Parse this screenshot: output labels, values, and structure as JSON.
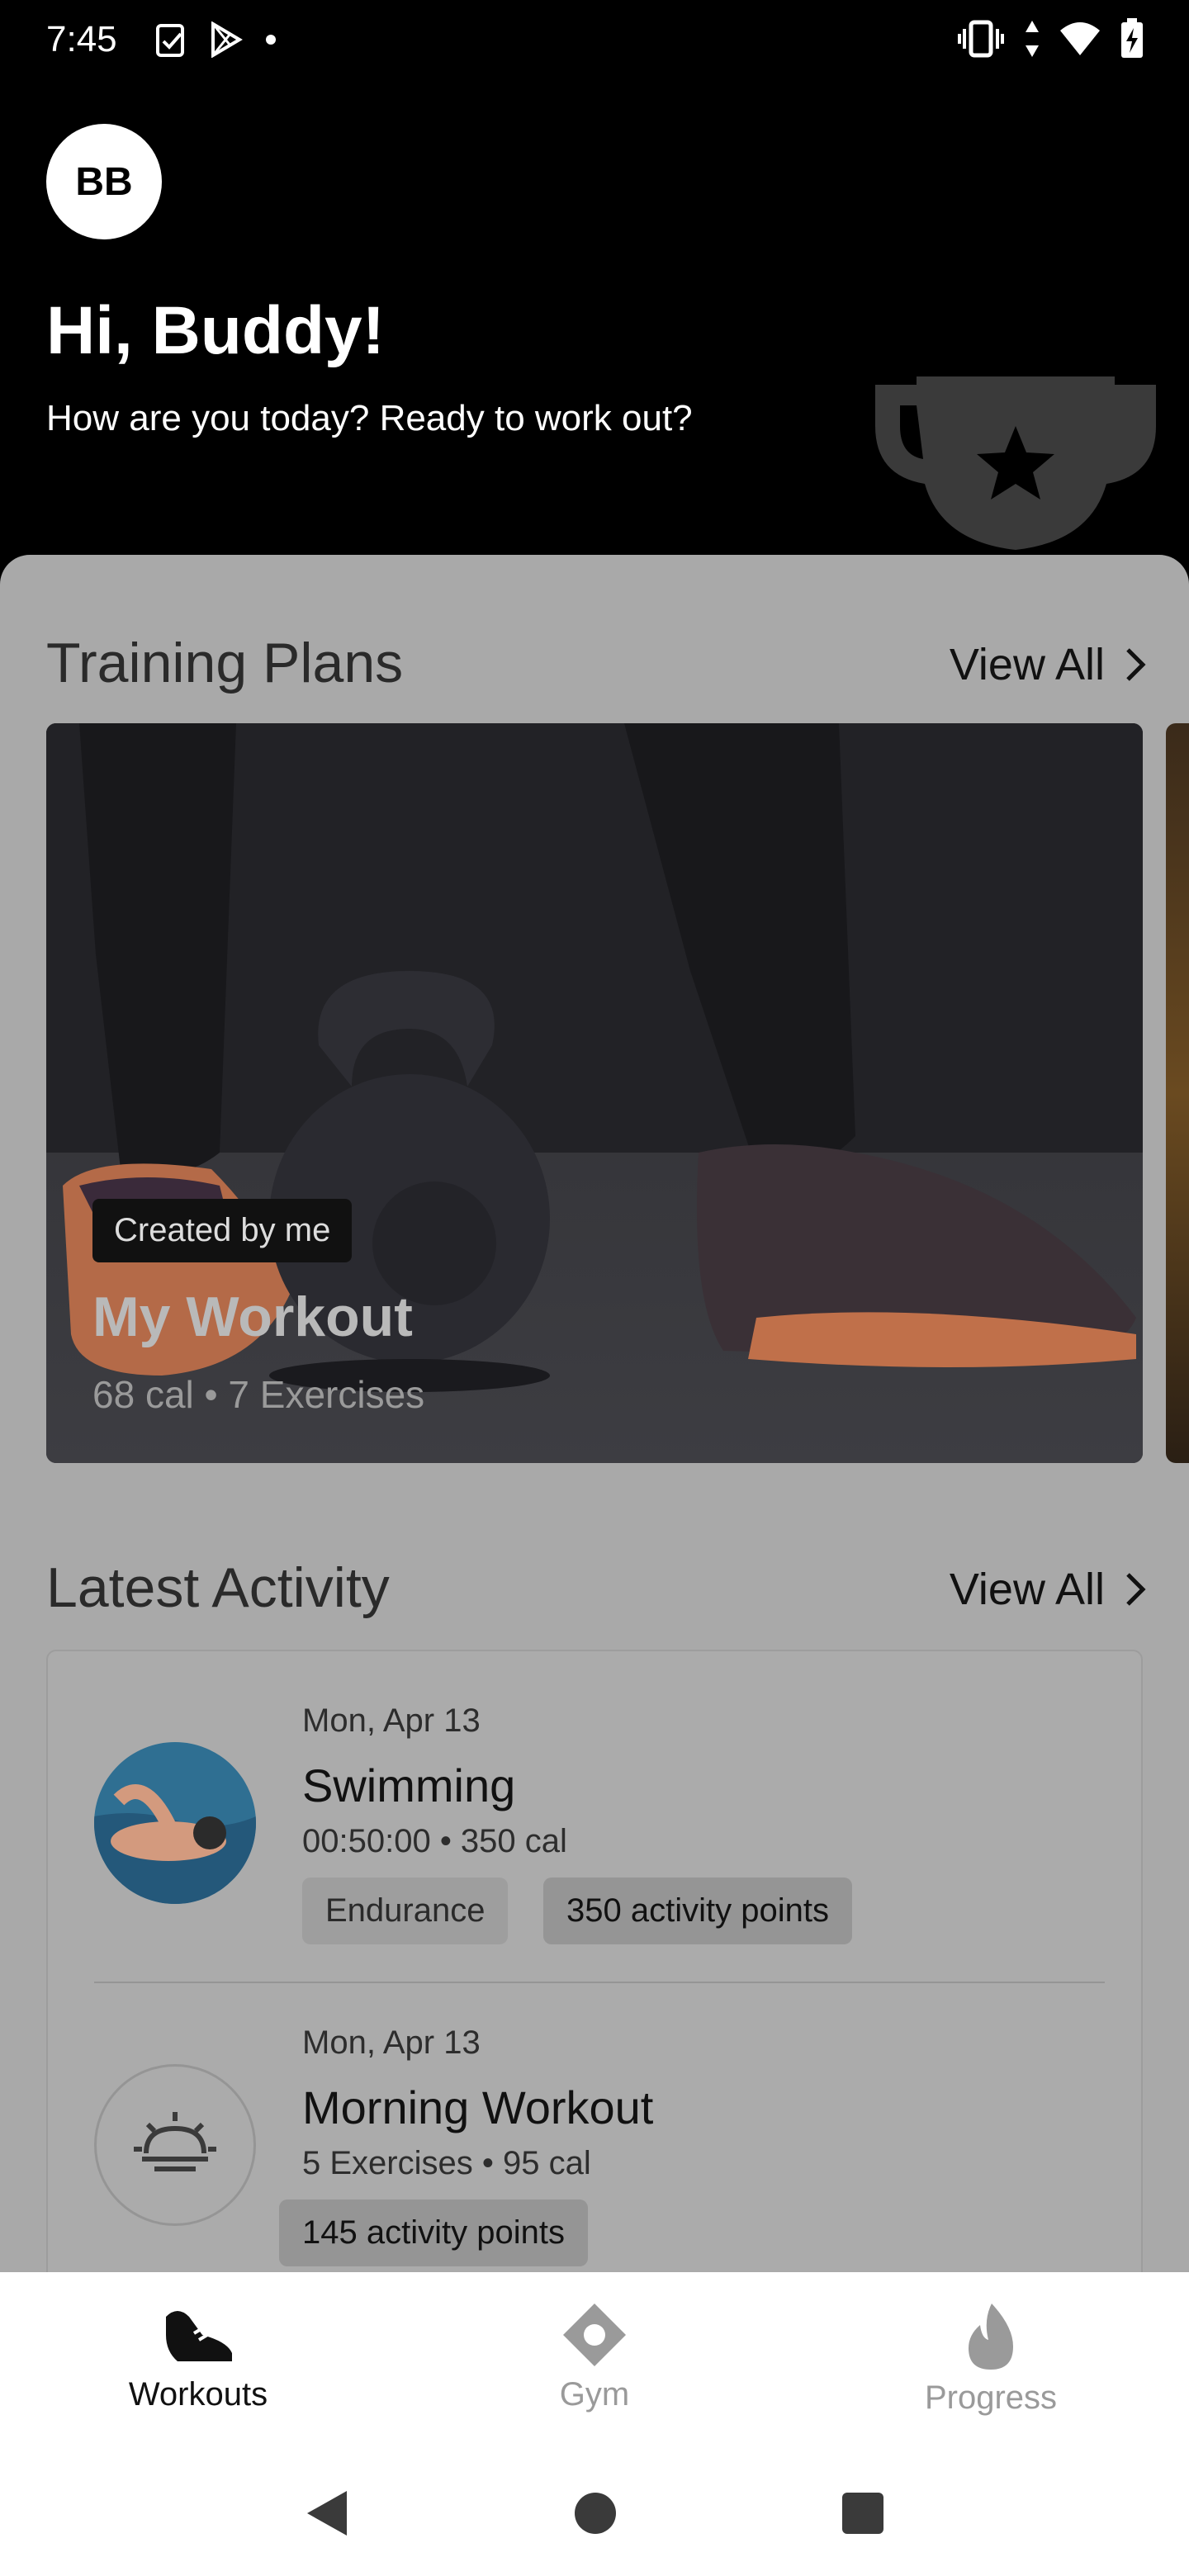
{
  "status_bar": {
    "time": "7:45",
    "left_icons": [
      "clipboard-check-icon",
      "play-store-icon",
      "dot-icon"
    ],
    "right_icons": [
      "vibrate-icon",
      "data-arrows-icon",
      "wifi-icon",
      "battery-charging-icon"
    ]
  },
  "header": {
    "avatar_initials": "BB",
    "greeting": "Hi, Buddy!",
    "subtitle": "How are you today? Ready to work out?"
  },
  "training_plans": {
    "title": "Training Plans",
    "view_all": "View All",
    "card": {
      "badge": "Created by me",
      "title": "My Workout",
      "meta": "68 cal • 7 Exercises"
    }
  },
  "latest_activity": {
    "title": "Latest Activity",
    "view_all": "View All",
    "items": [
      {
        "date": "Mon, Apr 13",
        "name": "Swimming",
        "meta": "00:50:00 • 350 cal",
        "tags": [
          "Endurance",
          "350 activity points"
        ]
      },
      {
        "date": "Mon, Apr 13",
        "name": "Morning Workout",
        "meta": "5 Exercises • 95 cal",
        "tags": [
          "145 activity points"
        ]
      }
    ]
  },
  "bottom_nav": {
    "items": [
      {
        "label": "Workouts",
        "icon": "shoe-icon",
        "active": true
      },
      {
        "label": "Gym",
        "icon": "location-diamond-icon",
        "active": false
      },
      {
        "label": "Progress",
        "icon": "flame-icon",
        "active": false
      }
    ]
  },
  "colors": {
    "header_bg": "#000000",
    "sheet_bg": "#a9a9a9",
    "nav_active": "#111111",
    "nav_inactive": "#9a9a9a"
  }
}
